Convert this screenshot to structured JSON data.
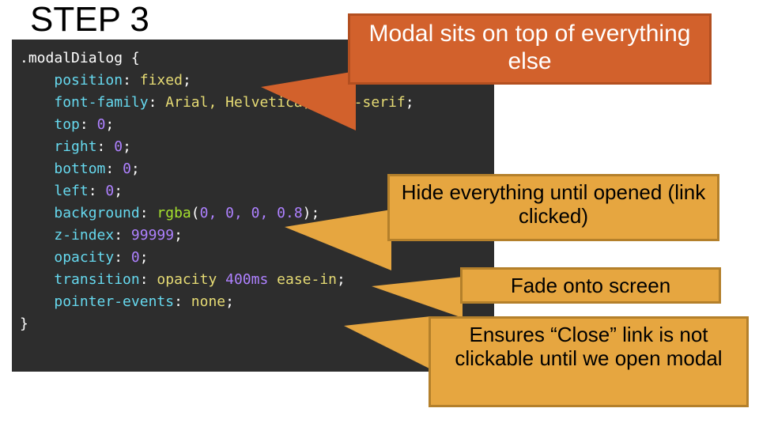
{
  "title": "STEP 3",
  "code": {
    "selector": ".modalDialog",
    "lines": [
      {
        "prop": "position",
        "val": "fixed"
      },
      {
        "prop": "font-family",
        "val": "Arial, Helvetica, sans-serif"
      },
      {
        "prop": "top",
        "num": "0"
      },
      {
        "prop": "right",
        "num": "0"
      },
      {
        "prop": "bottom",
        "num": "0"
      },
      {
        "prop": "left",
        "num": "0"
      },
      {
        "prop": "background",
        "func": "rgba",
        "args": "0, 0, 0, 0.8"
      },
      {
        "prop": "z-index",
        "num": "99999"
      },
      {
        "prop": "opacity",
        "num": "0"
      },
      {
        "prop": "transition",
        "compound": {
          "name": "opacity",
          "dur": "400ms",
          "timing": "ease-in"
        }
      },
      {
        "prop": "pointer-events",
        "val": "none"
      }
    ]
  },
  "callouts": {
    "c1": "Modal sits on top of everything else",
    "c2": "Hide everything until opened (link clicked)",
    "c3": "Fade onto screen",
    "c4": "Ensures “Close” link is not clickable until we open modal"
  }
}
